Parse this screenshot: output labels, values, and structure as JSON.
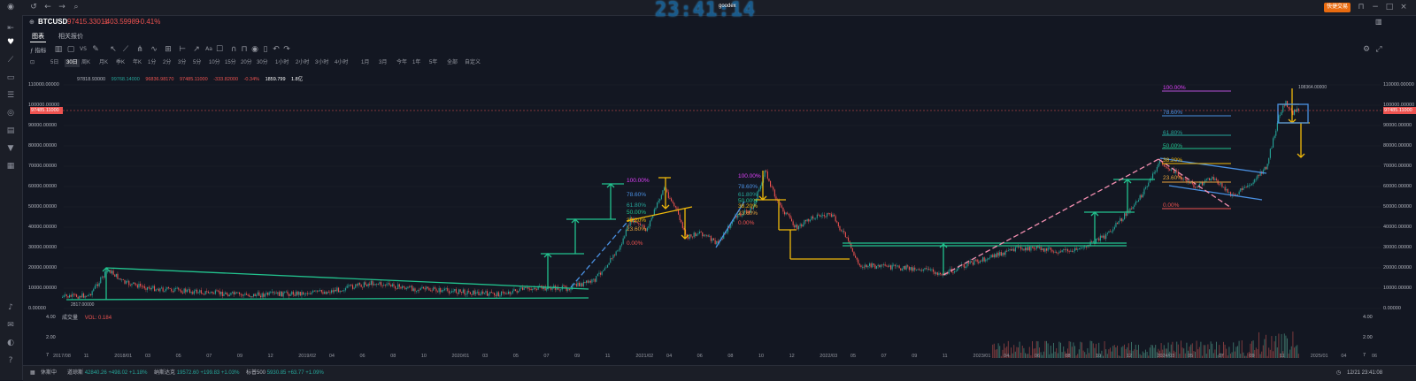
{
  "titlebar": {
    "clock": "23:41:14",
    "app_label": "goodex",
    "quick_trade_button": "快捷交易"
  },
  "symbol": {
    "name": "BTCUSD",
    "price": "97415.33011",
    "change": "-403.59989",
    "change_pct": "-0.41%"
  },
  "tabs": [
    "图表",
    "相关报价"
  ],
  "toolbar": {
    "indicators_label": "指标"
  },
  "periods": [
    "5日",
    "30日",
    "周K",
    "月K",
    "季K",
    "年K",
    "1分",
    "2分",
    "3分",
    "5分",
    "10分",
    "15分",
    "20分",
    "30分",
    "1小时",
    "2小时",
    "3小时",
    "4小时",
    "1月",
    "3月",
    "今年",
    "1年",
    "5年",
    "全部",
    "自定义"
  ],
  "active_period": "30日",
  "ohlc": {
    "date": "97818.93000",
    "open": "99768.14000",
    "high": "96836.98170",
    "low": "97485.11000",
    "close": "-333.82000",
    "change_pct": "-0.34%",
    "value1": "1859.799",
    "value2": "1.8亿"
  },
  "y_axis": [
    "110000.00000",
    "100000.00000",
    "90000.00000",
    "80000.00000",
    "70000.00000",
    "60000.00000",
    "50000.00000",
    "40000.00000",
    "30000.00000",
    "20000.00000",
    "10000.00000",
    "0.00000"
  ],
  "current_price_tag": "97485.11000",
  "vol_axis": [
    "4.00",
    "2.00",
    "7"
  ],
  "x_axis": [
    "2017/08",
    "11",
    "2018/01",
    "03",
    "05",
    "07",
    "09",
    "12",
    "2019/02",
    "04",
    "06",
    "08",
    "10",
    "2020/01",
    "03",
    "05",
    "07",
    "09",
    "11",
    "2021/02",
    "04",
    "06",
    "08",
    "10",
    "12",
    "2022/03",
    "05",
    "07",
    "09",
    "11",
    "2023/01",
    "04",
    "06",
    "08",
    "10",
    "12",
    "2024/03",
    "05",
    "07",
    "09",
    "11",
    "2025/01",
    "04",
    "06"
  ],
  "annotations": {
    "low_label": "2817.00000",
    "high_label": "108364.00000"
  },
  "fib_levels_a": [
    "100.00%",
    "78.60%",
    "61.80%",
    "50.00%",
    "38.20%",
    "23.60%",
    "0.00%"
  ],
  "fib_levels_b": [
    "100.00%",
    "78.60%",
    "61.80%",
    "50.00%",
    "38.20%",
    "23.60%",
    "0.00%"
  ],
  "fib_levels_c": [
    "100.00%",
    "78.60%",
    "61.80%",
    "50.00%",
    "38.20%",
    "23.60%",
    "0.00%"
  ],
  "volume": {
    "label": "成交量",
    "value": "VOL: 0.184"
  },
  "bottom": {
    "market": "休斯中",
    "tickers": [
      {
        "name": "道琼斯",
        "price": "42840.26",
        "chg": "+498.02",
        "pct": "+1.18%"
      },
      {
        "name": "纳斯达克",
        "price": "19572.60",
        "chg": "+199.83",
        "pct": "+1.03%"
      },
      {
        "name": "标普500",
        "price": "5930.85",
        "chg": "+63.77",
        "pct": "+1.09%"
      }
    ],
    "datetime": "12/21 23:41:08"
  },
  "colors": {
    "background": "#131722",
    "up": "#26a69a",
    "down": "#ef5350",
    "green_line": "#22c38e",
    "yellow_line": "#f0b90b",
    "blue_line": "#4a90e2",
    "pink_line": "#f48fb1",
    "orange_button": "#e96b10"
  }
}
